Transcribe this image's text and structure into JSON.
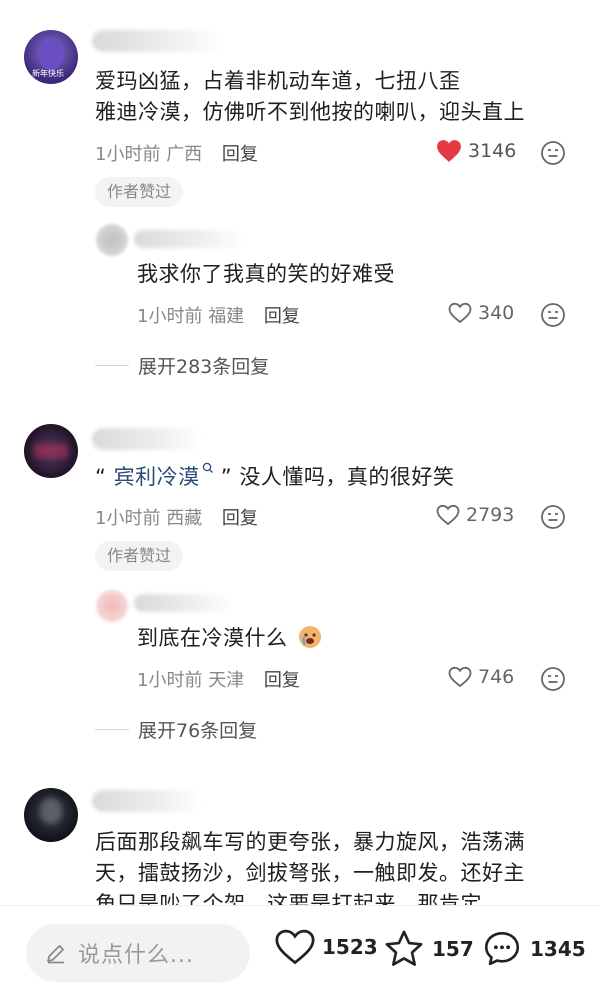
{
  "comments": [
    {
      "text_lines": [
        "爱玛凶猛，占着非机动车道，七扭八歪",
        "雅迪冷漠，仿佛听不到他按的喇叭，迎头直上"
      ],
      "time": "1小时前",
      "location": "广西",
      "reply_label": "回复",
      "likes": "3146",
      "liked": true,
      "badge": "作者赞过",
      "avatar_text": "新年快乐",
      "reply": {
        "text": "我求你了我真的笑的好难受",
        "time": "1小时前",
        "location": "福建",
        "reply_label": "回复",
        "likes": "340"
      },
      "expand": "展开283条回复"
    },
    {
      "quote_open": "“",
      "link_text": "宾利冷漠",
      "quote_close": "”",
      "text_after": "没人懂吗，真的很好笑",
      "time": "1小时前",
      "location": "西藏",
      "reply_label": "回复",
      "likes": "2793",
      "badge": "作者赞过",
      "reply": {
        "text": "到底在冷漠什么",
        "time": "1小时前",
        "location": "天津",
        "reply_label": "回复",
        "likes": "746"
      },
      "expand": "展开76条回复"
    },
    {
      "text_lines": [
        "后面那段飙车写的更夸张，暴力旋风，浩荡满",
        "天，擂鼓扬沙，剑拔弩张，一触即发。还好主",
        "角只是吵了个架，这要是打起来，那肯定"
      ]
    }
  ],
  "bottom_bar": {
    "placeholder": "说点什么...",
    "likes": "1523",
    "favorites": "157",
    "comments": "1345"
  },
  "colors": {
    "liked_heart": "#e53945",
    "link": "#2b4a7a"
  }
}
